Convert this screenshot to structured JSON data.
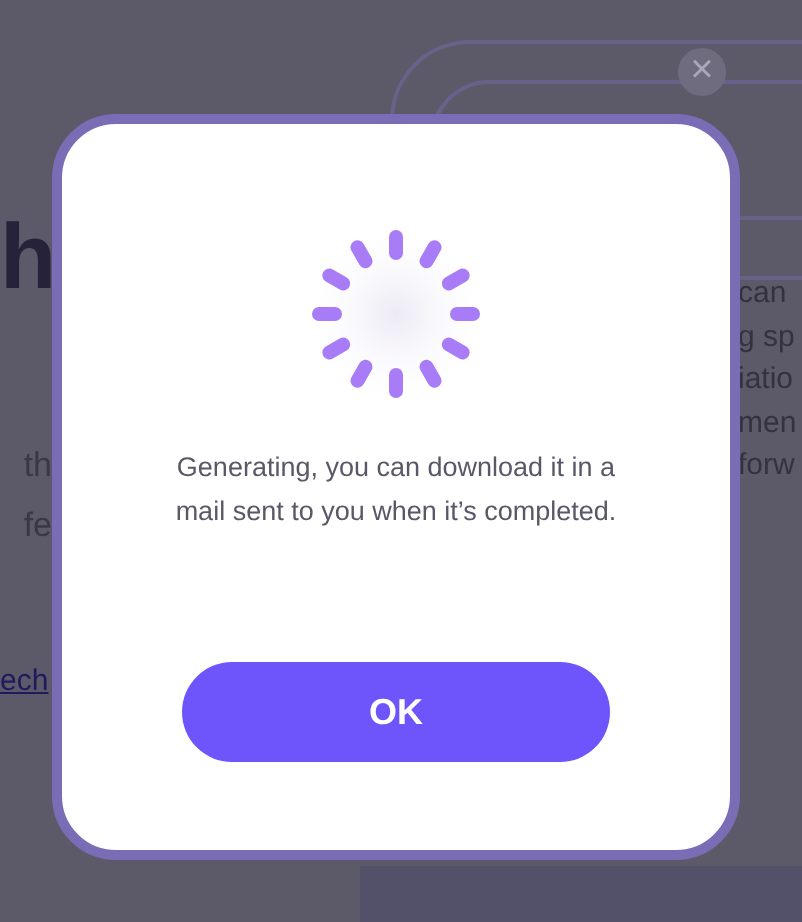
{
  "background": {
    "heading_fragment": "h",
    "left_lines": [
      "th",
      "fe"
    ],
    "link_fragment": "ech",
    "right_lines": [
      "can",
      "g sp",
      "iatio",
      "men",
      "forw"
    ],
    "close_label": "×"
  },
  "dialog": {
    "message": "Generating, you can download it in a mail sent to you when it’s completed.",
    "button": "OK"
  }
}
